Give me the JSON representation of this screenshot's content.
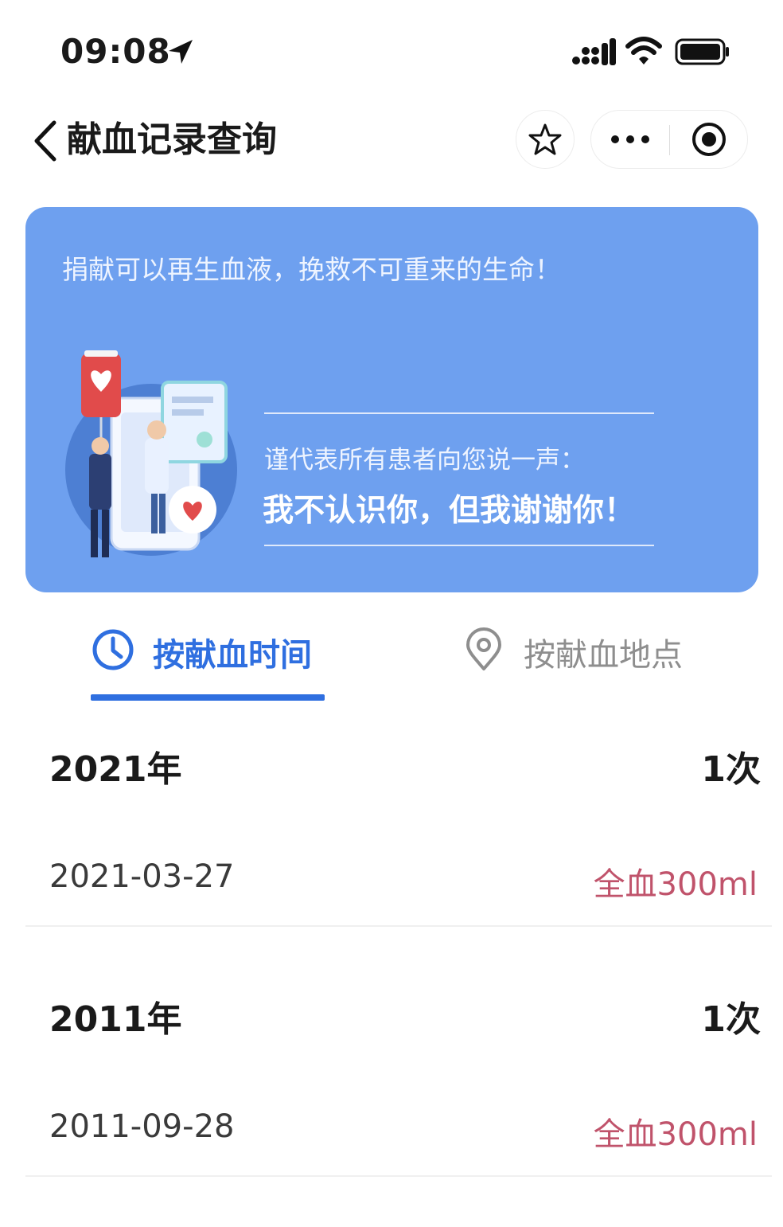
{
  "status_bar": {
    "time": "09:08"
  },
  "nav": {
    "title": "献血记录查询"
  },
  "banner": {
    "slogan": "捐献可以再生血液，挽救不可重来的生命！",
    "sub": "谨代表所有患者向您说一声：",
    "thanks": "我不认识你，但我谢谢你！"
  },
  "tabs": [
    {
      "label": "按献血时间",
      "icon": "clock-icon",
      "active": true
    },
    {
      "label": "按献血地点",
      "icon": "location-pin-icon",
      "active": false
    }
  ],
  "records": [
    {
      "year": "2021年",
      "count": "1次",
      "items": [
        {
          "date": "2021-03-27",
          "amount": "全血300ml"
        }
      ]
    },
    {
      "year": "2011年",
      "count": "1次",
      "items": [
        {
          "date": "2011-09-28",
          "amount": "全血300ml"
        }
      ]
    }
  ],
  "colors": {
    "accent": "#2f6fe0",
    "banner_bg": "#6ea0ef",
    "amount": "#c0536b"
  }
}
